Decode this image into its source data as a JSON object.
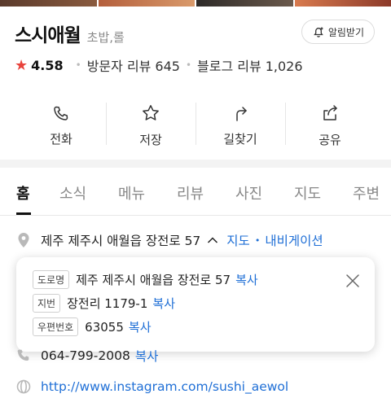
{
  "place": {
    "name": "스시애월",
    "category": "초밥,롤",
    "alarm_button": "알림받기"
  },
  "rating": {
    "score": "4.58",
    "visitor_review_label": "방문자 리뷰",
    "visitor_review_count": "645",
    "blog_review_label": "블로그 리뷰",
    "blog_review_count": "1,026"
  },
  "actions": [
    {
      "label": "전화",
      "icon": "phone-icon"
    },
    {
      "label": "저장",
      "icon": "star-outline-icon"
    },
    {
      "label": "길찾기",
      "icon": "directions-icon"
    },
    {
      "label": "공유",
      "icon": "share-icon"
    }
  ],
  "tabs": [
    "홈",
    "소식",
    "메뉴",
    "리뷰",
    "사진",
    "지도",
    "주변"
  ],
  "active_tab": "홈",
  "address": {
    "text": "제주 제주시 애월읍 장전로 57",
    "map_link": "지도",
    "nav_link": "내비게이션"
  },
  "address_popup": {
    "rows": [
      {
        "badge": "도로명",
        "value": "제주 제주시 애월읍 장전로 57",
        "copy": "복사"
      },
      {
        "badge": "지번",
        "value": "장전리 1179-1",
        "copy": "복사"
      },
      {
        "badge": "우편번호",
        "value": "63055",
        "copy": "복사"
      }
    ]
  },
  "phone": {
    "number": "064-799-2008",
    "copy": "복사"
  },
  "website": {
    "url": "http://www.instagram.com/sushi_aewol"
  },
  "colors": {
    "accent_blue": "#1f6fd6",
    "star_red": "#e8433c"
  }
}
